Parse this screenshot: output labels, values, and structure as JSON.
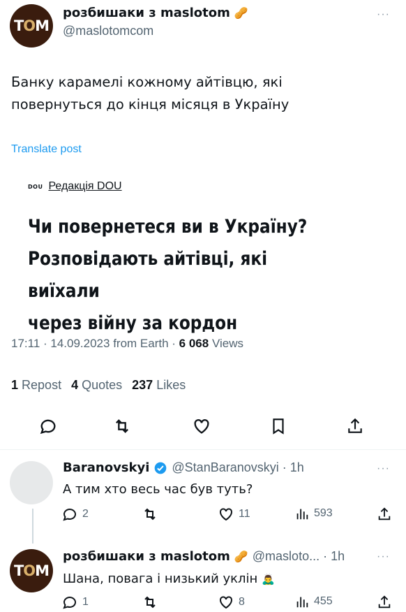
{
  "tweet": {
    "author_name": "розбишаки з maslotom",
    "author_handle": "@maslotomcom",
    "avatar_text_a": "Т",
    "avatar_text_b": "М",
    "avatar_text_mid": "О",
    "text_line1": "Банку карамелі кожному айтівцю, які",
    "text_line2": "повернуться до кінця місяця в Україну",
    "translate_label": "Translate post",
    "card": {
      "logo": "DOU",
      "source": "Редакція DOU",
      "headline_line1": "Чи повернетеся ви в Україну?",
      "headline_line2": "Розповідають айтівці, які виїхали",
      "headline_line3": "через війну за кордон"
    },
    "time": "17:11 · 14.09.2023 from Earth ·",
    "views_count": "6 068",
    "views_label": "Views",
    "reposts_count": "1",
    "reposts_label": "Repost",
    "quotes_count": "4",
    "quotes_label": "Quotes",
    "likes_count": "237",
    "likes_label": "Likes"
  },
  "replies": [
    {
      "name": "Baranovskyi",
      "handle": "@StanBaranovskyi · 1h",
      "text": "А тим хто весь час був туть?",
      "replies": "2",
      "likes": "11",
      "views": "593"
    },
    {
      "name": "розбишаки з maslotom",
      "handle": "@masloto... · 1h",
      "text": "Шана, повага і низький уклін",
      "replies": "1",
      "likes": "8",
      "views": "455"
    }
  ],
  "more_label": "···",
  "colors": {
    "accent": "#1d9bf0",
    "muted": "#536471",
    "avatar_bg": "#3a1c0e",
    "avatar_brand": "#d9b06b"
  }
}
